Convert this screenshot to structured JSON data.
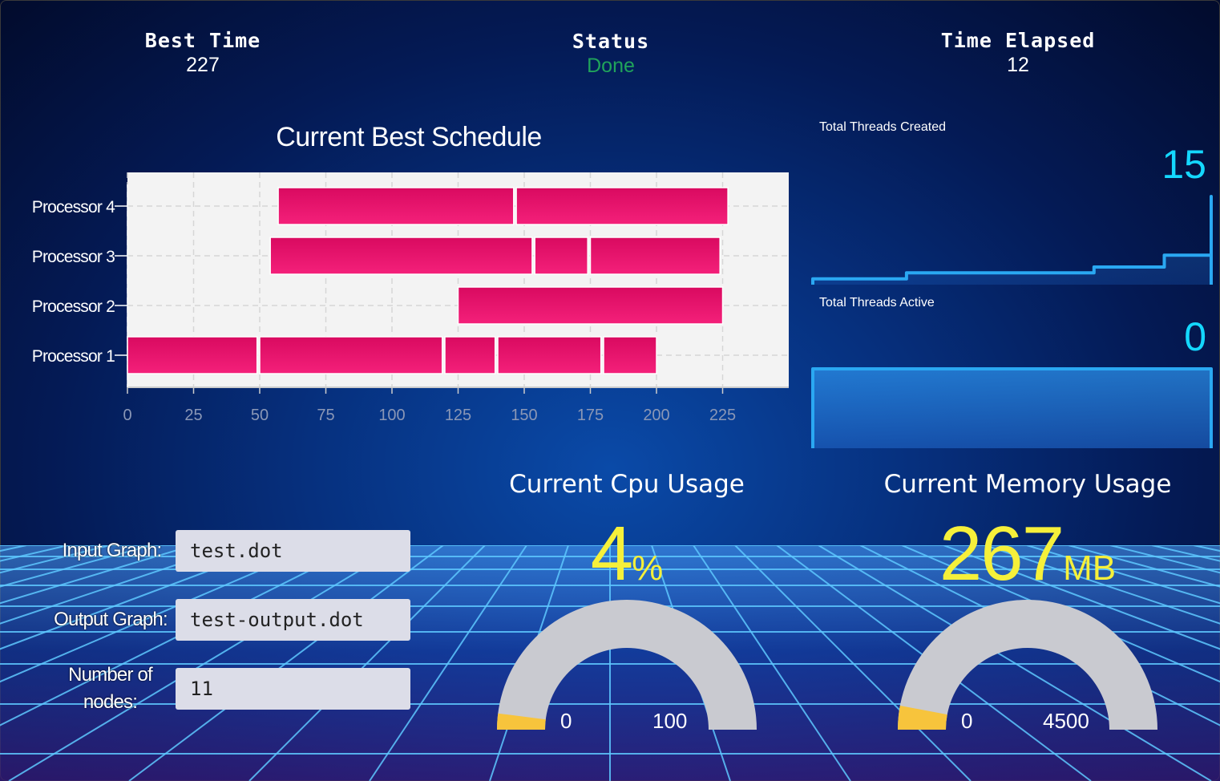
{
  "header": {
    "best_time": {
      "label": "Best Time",
      "value": "227"
    },
    "status": {
      "label": "Status",
      "value": "Done",
      "color": "#20a35b"
    },
    "time_elapsed": {
      "label": "Time Elapsed",
      "value": "12"
    }
  },
  "schedule": {
    "title": "Current Best Schedule",
    "chart_data": {
      "type": "bar",
      "orientation": "horizontal-stacked",
      "categories": [
        "Processor 4",
        "Processor 3",
        "Processor 2",
        "Processor 1"
      ],
      "x_ticks": [
        "0",
        "25",
        "50",
        "75",
        "100",
        "125",
        "150",
        "175",
        "200",
        "225"
      ],
      "xlim": [
        0,
        250
      ],
      "grid": true,
      "bar_color": "#e8106a",
      "tasks": [
        {
          "row": "Processor 4",
          "start": 57,
          "end": 146
        },
        {
          "row": "Processor 4",
          "start": 147,
          "end": 227
        },
        {
          "row": "Processor 3",
          "start": 54,
          "end": 153
        },
        {
          "row": "Processor 3",
          "start": 154,
          "end": 174
        },
        {
          "row": "Processor 3",
          "start": 175,
          "end": 224
        },
        {
          "row": "Processor 2",
          "start": 125,
          "end": 225
        },
        {
          "row": "Processor 1",
          "start": 0,
          "end": 49
        },
        {
          "row": "Processor 1",
          "start": 50,
          "end": 119
        },
        {
          "row": "Processor 1",
          "start": 120,
          "end": 139
        },
        {
          "row": "Processor 1",
          "start": 140,
          "end": 179
        },
        {
          "row": "Processor 1",
          "start": 180,
          "end": 200
        }
      ]
    }
  },
  "threads_created": {
    "label": "Total Threads Created",
    "value": "15",
    "color": "#2aa8f2",
    "chart_data": {
      "type": "area",
      "y": [
        1,
        1,
        1,
        1,
        2,
        2,
        2,
        2,
        2,
        2,
        2,
        2,
        3,
        3,
        3,
        5,
        5,
        15
      ],
      "ylim": [
        0,
        15
      ]
    }
  },
  "threads_active": {
    "label": "Total Threads Active",
    "value": "0",
    "color": "#2aa8f2",
    "chart_data": {
      "type": "area",
      "y": [
        0,
        0,
        0,
        0,
        0,
        0,
        0,
        0,
        0,
        0,
        0,
        0,
        0,
        0,
        0,
        0,
        0,
        0
      ],
      "ylim": [
        0,
        1
      ]
    }
  },
  "cpu": {
    "title": "Current Cpu Usage",
    "value": "4",
    "unit": "%",
    "min_label": "0",
    "max_label": "100",
    "fraction": 0.04,
    "fill_color": "#f7c43c"
  },
  "memory": {
    "title": "Current Memory Usage",
    "value": "267",
    "unit": "MB",
    "min_label": "0",
    "max_label": "4500",
    "fraction": 0.0593,
    "fill_color": "#f7c43c"
  },
  "form": {
    "input_graph": {
      "label": "Input Graph:",
      "value": "test.dot"
    },
    "output_graph": {
      "label": "Output Graph:",
      "value": "test-output.dot"
    },
    "num_nodes": {
      "label": "Number of nodes:",
      "value": "11"
    }
  }
}
